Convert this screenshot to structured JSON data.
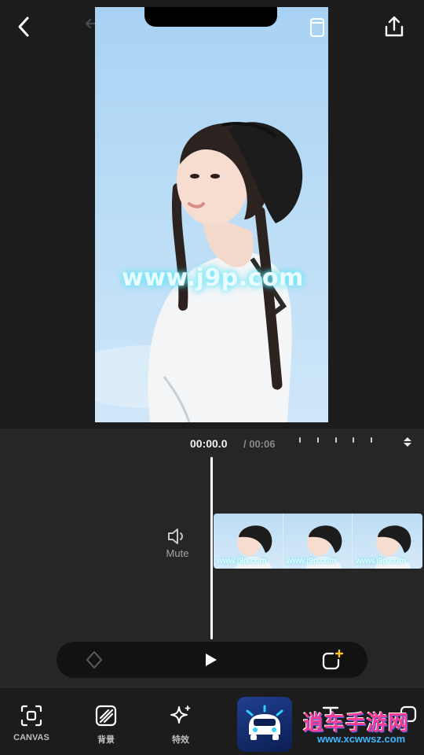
{
  "editor": {
    "timecode": "00:00.0",
    "duration": "/ 00:06"
  },
  "preview": {
    "watermark": "www.j9p.com"
  },
  "timeline": {
    "mute_label": "Mute",
    "clip_watermark": "www.j9p.com"
  },
  "toolbar": {
    "items": [
      {
        "label": "CANVAS",
        "icon": "canvas-icon"
      },
      {
        "label": "背景",
        "icon": "background-icon"
      },
      {
        "label": "特效",
        "icon": "sparkle-icon"
      }
    ]
  },
  "overlay_watermark": {
    "title": "逍车手游网",
    "url": "www.xcwwsz.com"
  },
  "colors": {
    "background": "#1c1c1c",
    "timeline_bg": "#262626",
    "player_bar": "#121212",
    "sky": "#b9dcf6"
  }
}
